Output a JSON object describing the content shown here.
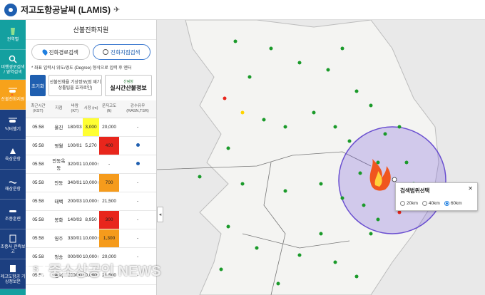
{
  "app": {
    "title": "저고도항공날씨 (LAMIS)"
  },
  "sidebar": {
    "items": [
      {
        "label": "권역별",
        "icon": "map-icon"
      },
      {
        "label": "비행경로검색 / 영역검색",
        "icon": "search-icon"
      },
      {
        "label": "산불진화지원",
        "icon": "helicopter-fire-icon"
      },
      {
        "label": "닥터헬기",
        "icon": "doctor-helicopter-icon"
      },
      {
        "label": "육상운항",
        "icon": "land-operation-icon"
      },
      {
        "label": "해상운항",
        "icon": "sea-operation-icon"
      },
      {
        "label": "조종훈련",
        "icon": "training-icon"
      },
      {
        "label": "조종사 관측보고",
        "icon": "pilot-report-icon"
      },
      {
        "label": "제고도항공 기상정보문",
        "icon": "document-icon"
      }
    ]
  },
  "panel": {
    "title": "산불진화지원",
    "tabs": [
      {
        "label": "진화경로검색"
      },
      {
        "label": "진화지점검색"
      }
    ],
    "hint": "* 좌표 입력시 위도/경도 (Degree) 형식으로 입력 후 엔터",
    "init_button": "초기화",
    "weather_button": "산불진화율 기상정보(점 재기상툴팁을 효과로인)",
    "forest_small": "산림청",
    "forest_big": "실시간산불정보",
    "table": {
      "headers": [
        "최근시간 (KST)",
        "지점",
        "바람 (KT)",
        "시정 (m)",
        "운저고도 (ft)",
        "강수유무 (RASN,TSR)"
      ],
      "rows": [
        {
          "time": "05:58",
          "station": "울진",
          "wind": "180/03",
          "vis": "3,000",
          "ceil": "20,000",
          "precip": "-"
        },
        {
          "time": "05:58",
          "station": "영월",
          "wind": "100/01",
          "vis": "5,270",
          "ceil": "400",
          "precip": "●"
        },
        {
          "time": "05:58",
          "station": "안동옥동",
          "wind": "320/01",
          "vis": "10,000↑",
          "ceil": "-",
          "precip": "●"
        },
        {
          "time": "05:58",
          "station": "안동",
          "wind": "340/01",
          "vis": "10,000↑",
          "ceil": "700",
          "precip": "-"
        },
        {
          "time": "05:58",
          "station": "태백",
          "wind": "200/03",
          "vis": "10,000↑",
          "ceil": "21,500",
          "precip": "-"
        },
        {
          "time": "05:58",
          "station": "봉화",
          "wind": "140/03",
          "vis": "8,950",
          "ceil": "300",
          "precip": "-"
        },
        {
          "time": "05:58",
          "station": "영주",
          "wind": "330/01",
          "vis": "10,000↑",
          "ceil": "1,300",
          "precip": "-"
        },
        {
          "time": "05:58",
          "station": "청송",
          "wind": "000/00",
          "vis": "10,000↑",
          "ceil": "20,000",
          "precip": "-"
        },
        {
          "time": "05:58",
          "station": "영덕",
          "wind": "000/00",
          "vis": "10,000↑",
          "ceil": "21,500",
          "precip": "-"
        }
      ]
    }
  },
  "popup": {
    "title": "검색범위선택",
    "options": [
      "20km",
      "40km",
      "60km"
    ],
    "selected": "60km"
  },
  "watermark": "중소상공인 NEWS",
  "colors": {
    "sidebar": "#14a0a0",
    "active": "#f7a21b",
    "accent": "#1f5fb0"
  }
}
